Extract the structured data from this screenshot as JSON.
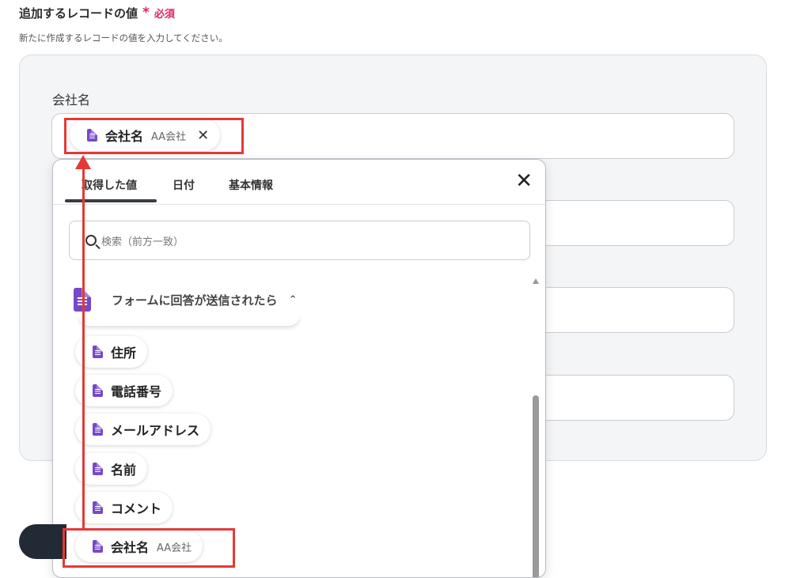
{
  "section": {
    "title": "追加するレコードの値",
    "required_mark": "*",
    "required_label": "必須",
    "description": "新たに作成するレコードの値を入力してください。"
  },
  "field": {
    "label": "会社名",
    "token": {
      "name": "会社名",
      "value": "AA会社",
      "icon": "google-forms-icon"
    }
  },
  "dropdown": {
    "tabs": [
      {
        "label": "取得した値",
        "active": true
      },
      {
        "label": "日付",
        "active": false
      },
      {
        "label": "基本情報",
        "active": false
      }
    ],
    "search_placeholder": "検索（前方一致）",
    "group": {
      "label": "フォームに回答が送信されたら",
      "expanded": true,
      "icon": "google-forms-icon"
    },
    "items": [
      {
        "name": "住所",
        "value": ""
      },
      {
        "name": "電話番号",
        "value": ""
      },
      {
        "name": "メールアドレス",
        "value": ""
      },
      {
        "name": "名前",
        "value": ""
      },
      {
        "name": "コメント",
        "value": ""
      },
      {
        "name": "会社名",
        "value": "AA会社"
      }
    ]
  },
  "colors": {
    "accent": "#7848c8",
    "highlight": "#e53935",
    "required": "#e0245e"
  }
}
